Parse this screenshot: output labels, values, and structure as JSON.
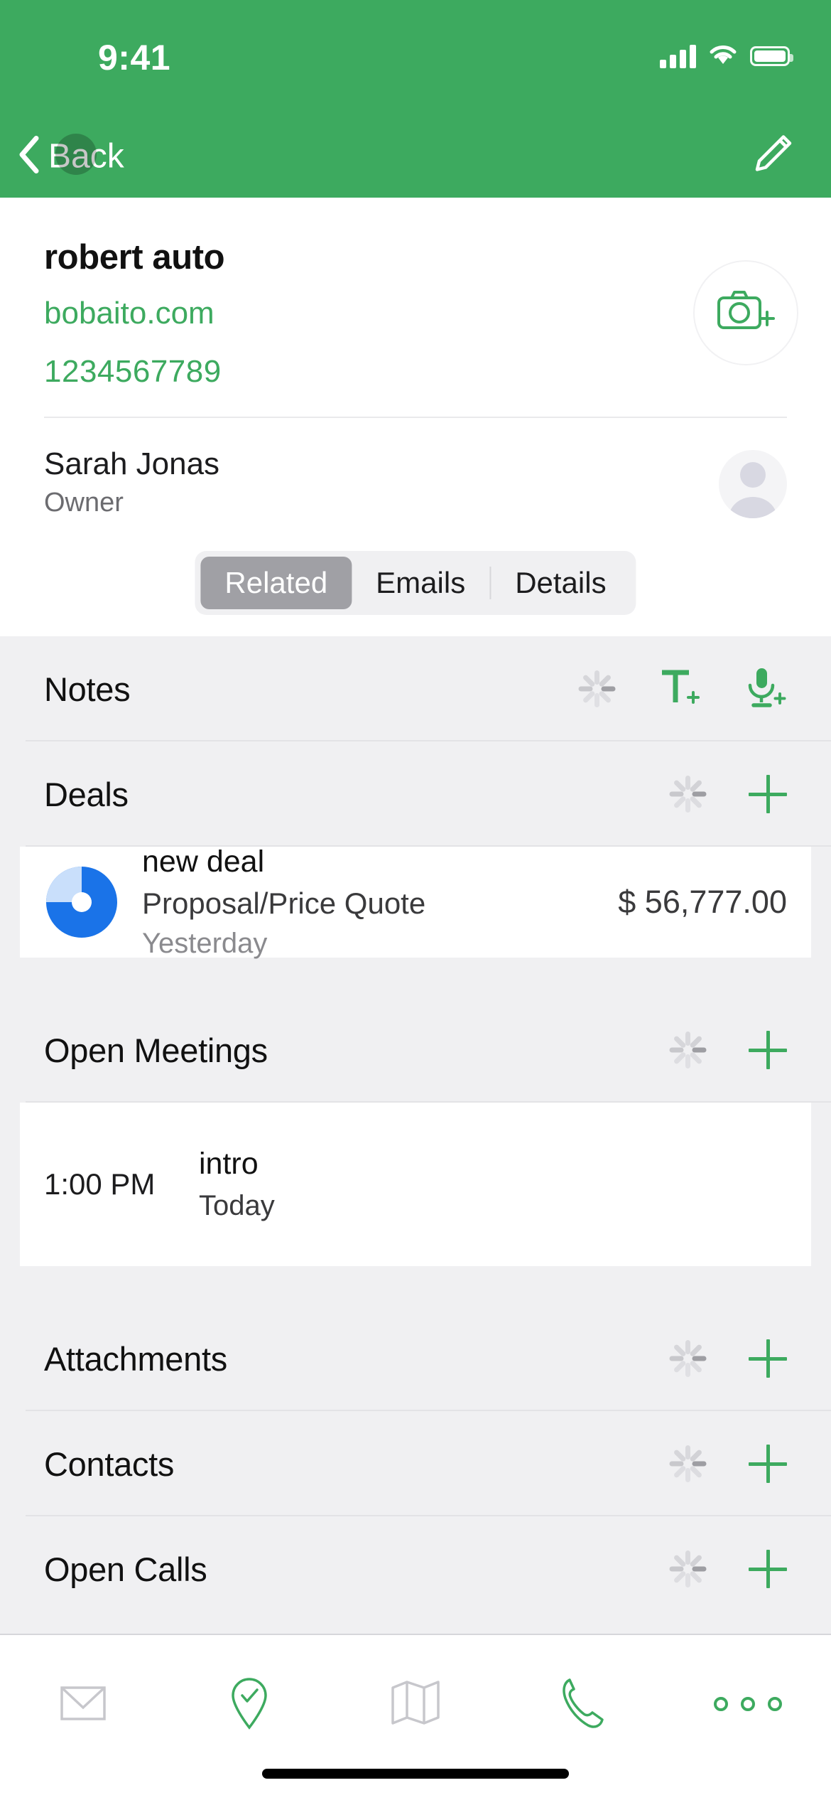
{
  "status_bar": {
    "time": "9:41",
    "signal_icon": "cellular-signal-icon",
    "wifi_icon": "wifi-icon",
    "battery_icon": "battery-full-icon"
  },
  "nav": {
    "back_label": "Back",
    "back_icon": "chevron-left-icon",
    "edit_icon": "pencil-edit-icon"
  },
  "account": {
    "name": "robert auto",
    "website": "bobaito.com",
    "phone": "1234567789",
    "photo_button_icon": "camera-add-icon"
  },
  "owner": {
    "name": "Sarah Jonas",
    "role": "Owner",
    "avatar_icon": "person-avatar-icon"
  },
  "tabs": {
    "items": [
      {
        "label": "Related",
        "selected": true
      },
      {
        "label": "Emails",
        "selected": false
      },
      {
        "label": "Details",
        "selected": false
      }
    ]
  },
  "sections": [
    {
      "title": "Notes",
      "actions": [
        "loading-spinner-icon",
        "add-text-note-icon",
        "add-voice-note-icon"
      ]
    },
    {
      "title": "Deals",
      "actions": [
        "loading-spinner-icon",
        "plus-icon"
      ]
    },
    {
      "title": "Open Meetings",
      "actions": [
        "loading-spinner-icon",
        "plus-icon"
      ]
    },
    {
      "title": "Attachments",
      "actions": [
        "loading-spinner-icon",
        "plus-icon"
      ]
    },
    {
      "title": "Contacts",
      "actions": [
        "loading-spinner-icon",
        "plus-icon"
      ]
    },
    {
      "title": "Open Calls",
      "actions": [
        "loading-spinner-icon",
        "plus-icon"
      ]
    }
  ],
  "deal": {
    "name": "new deal",
    "stage": "Proposal/Price Quote",
    "date": "Yesterday",
    "amount": "$ 56,777.00",
    "progress_percent": 75
  },
  "meeting": {
    "time": "1:00 PM",
    "title": "intro",
    "date": "Today"
  },
  "tabbar": {
    "items": [
      {
        "icon": "email-icon",
        "active": false
      },
      {
        "icon": "check-in-pin-icon",
        "active": true
      },
      {
        "icon": "map-icon",
        "active": false
      },
      {
        "icon": "phone-call-icon",
        "active": true
      },
      {
        "icon": "more-options-icon",
        "active": true
      }
    ]
  },
  "colors": {
    "brand_green": "#3DAA5F",
    "content_background": "#F0F0F2",
    "deal_progress_blue": "#1A73E8",
    "deal_progress_track": "#C9DFFB",
    "inactive_gray": "#C7C7CC"
  }
}
